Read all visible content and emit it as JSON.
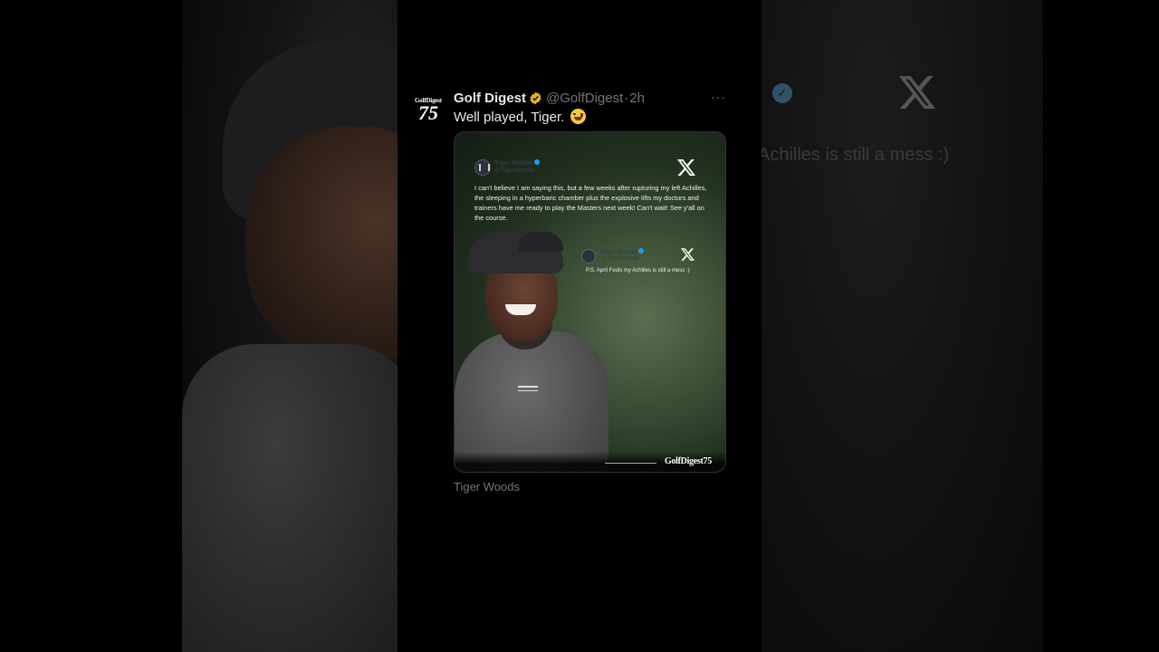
{
  "background": {
    "right_text": "Achilles is still a mess :)"
  },
  "tweet": {
    "author_name": "Golf Digest",
    "handle": "@GolfDigest",
    "separator": "·",
    "time": "2h",
    "text": "Well played, Tiger.",
    "emoji": "face-with-tears-of-joy",
    "more_label": "···",
    "avatar": {
      "top_text": "GolfDigest",
      "number": "75"
    },
    "media_caption": "Tiger Woods"
  },
  "embedded": {
    "tweet1": {
      "name": "Tiger Woods",
      "handle": "@TigerWoods",
      "text": "I can't believe I am saying this, but a few weeks after rupturing my left Achilles, the sleeping in a hyperbaric chamber plus the explosive lifts my doctors and trainers have me ready to play the Masters next week! Can't wait! See y'all on the course."
    },
    "tweet2": {
      "name": "Tiger Woods",
      "handle": "@TigerWoods",
      "text": "P.S. April Fools my Achilles is still a mess :)"
    },
    "watermark": "GolfDigest75"
  },
  "colors": {
    "verified_gold": "#e2b719",
    "verified_blue": "#1d9bf0",
    "text_primary": "#e7e9ea",
    "text_secondary": "#71767b",
    "background": "#000000"
  }
}
